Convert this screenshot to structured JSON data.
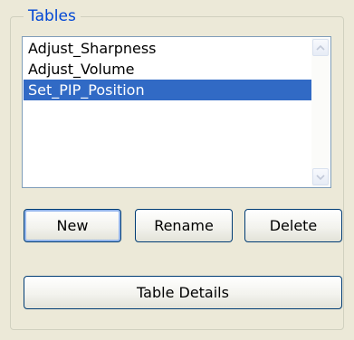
{
  "groupbox": {
    "title": "Tables"
  },
  "list": {
    "items": [
      "Adjust_Sharpness",
      "Adjust_Volume",
      "Set_PIP_Position"
    ],
    "selected_index": 2
  },
  "buttons": {
    "new": "New",
    "rename": "Rename",
    "delete": "Delete",
    "details": "Table Details"
  },
  "colors": {
    "title": "#0046d5",
    "selection": "#316ac5",
    "button_border": "#003c74"
  }
}
